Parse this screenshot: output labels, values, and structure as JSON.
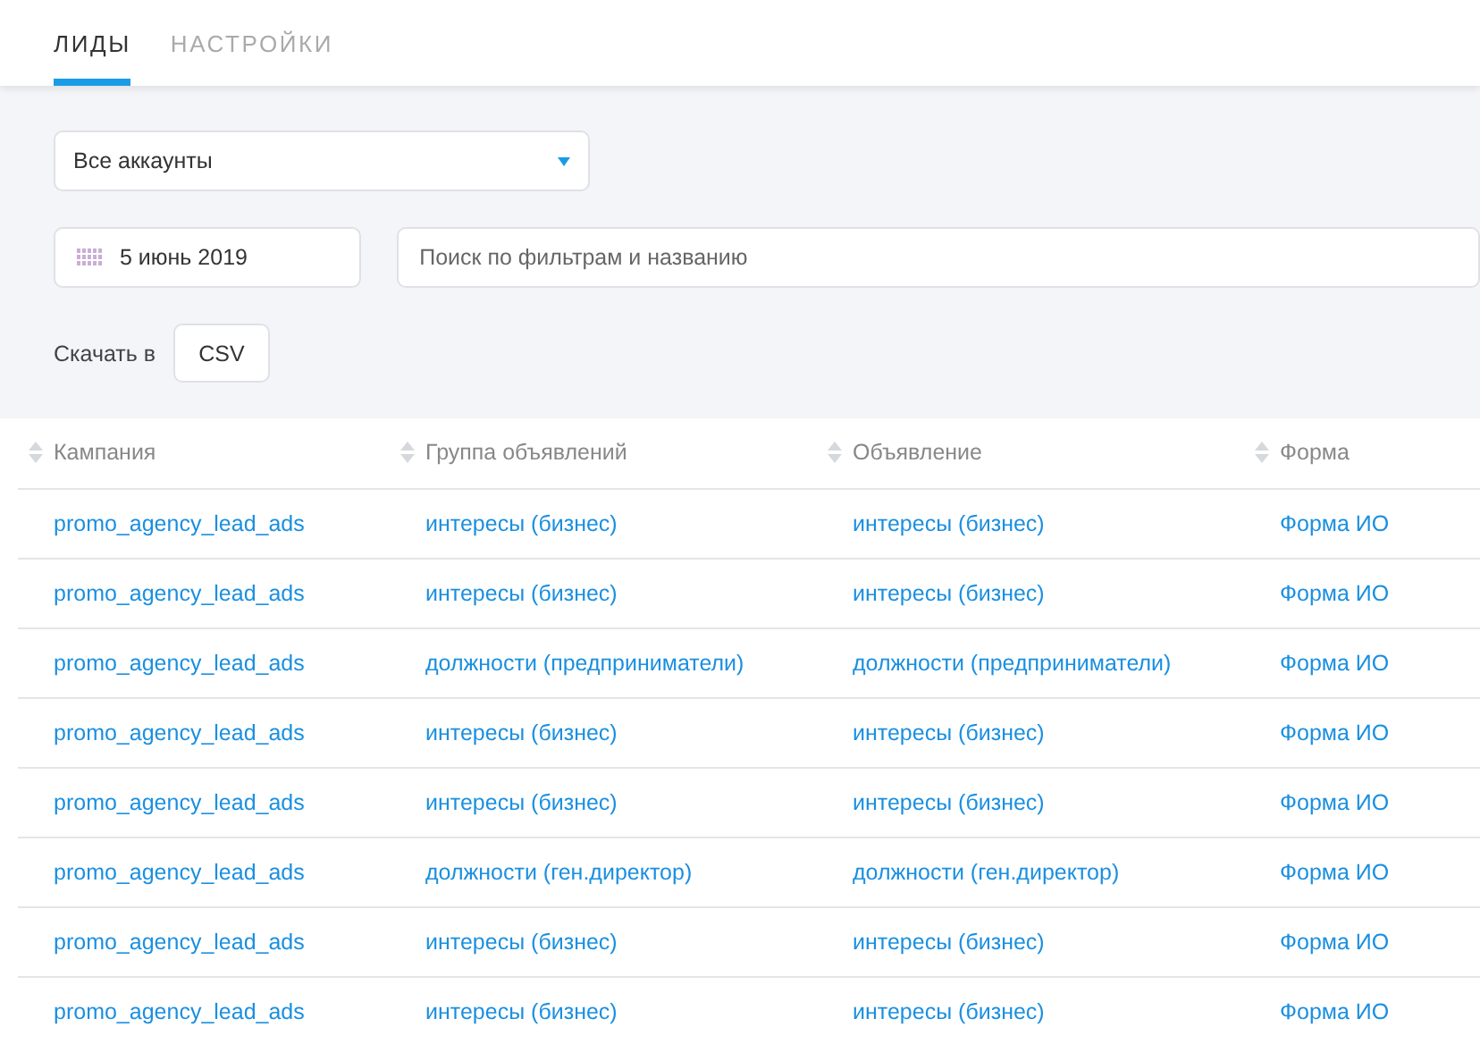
{
  "tabs": [
    {
      "label": "ЛИДЫ",
      "selected": true
    },
    {
      "label": "НАСТРОЙКИ",
      "selected": false
    }
  ],
  "account_select": {
    "value": "Все аккаунты"
  },
  "date_field": {
    "value": "5 июнь 2019"
  },
  "search": {
    "placeholder": "Поиск по фильтрам и названию"
  },
  "download": {
    "label": "Скачать в",
    "button": "CSV"
  },
  "table": {
    "columns": [
      "Кампания",
      "Группа объявлений",
      "Объявление",
      "Форма"
    ],
    "rows": [
      [
        "promo_agency_lead_ads",
        "интересы (бизнес)",
        "интересы (бизнес)",
        "Форма ИО"
      ],
      [
        "promo_agency_lead_ads",
        "интересы (бизнес)",
        "интересы (бизнес)",
        "Форма ИО"
      ],
      [
        "promo_agency_lead_ads",
        "должности (предприниматели)",
        "должности (предприниматели)",
        "Форма ИО"
      ],
      [
        "promo_agency_lead_ads",
        "интересы (бизнес)",
        "интересы (бизнес)",
        "Форма ИО"
      ],
      [
        "promo_agency_lead_ads",
        "интересы (бизнес)",
        "интересы (бизнес)",
        "Форма ИО"
      ],
      [
        "promo_agency_lead_ads",
        "должности (ген.директор)",
        "должности (ген.директор)",
        "Форма ИО"
      ],
      [
        "promo_agency_lead_ads",
        "интересы (бизнес)",
        "интересы (бизнес)",
        "Форма ИО"
      ],
      [
        "promo_agency_lead_ads",
        "интересы (бизнес)",
        "интересы (бизнес)",
        "Форма ИО"
      ]
    ]
  }
}
